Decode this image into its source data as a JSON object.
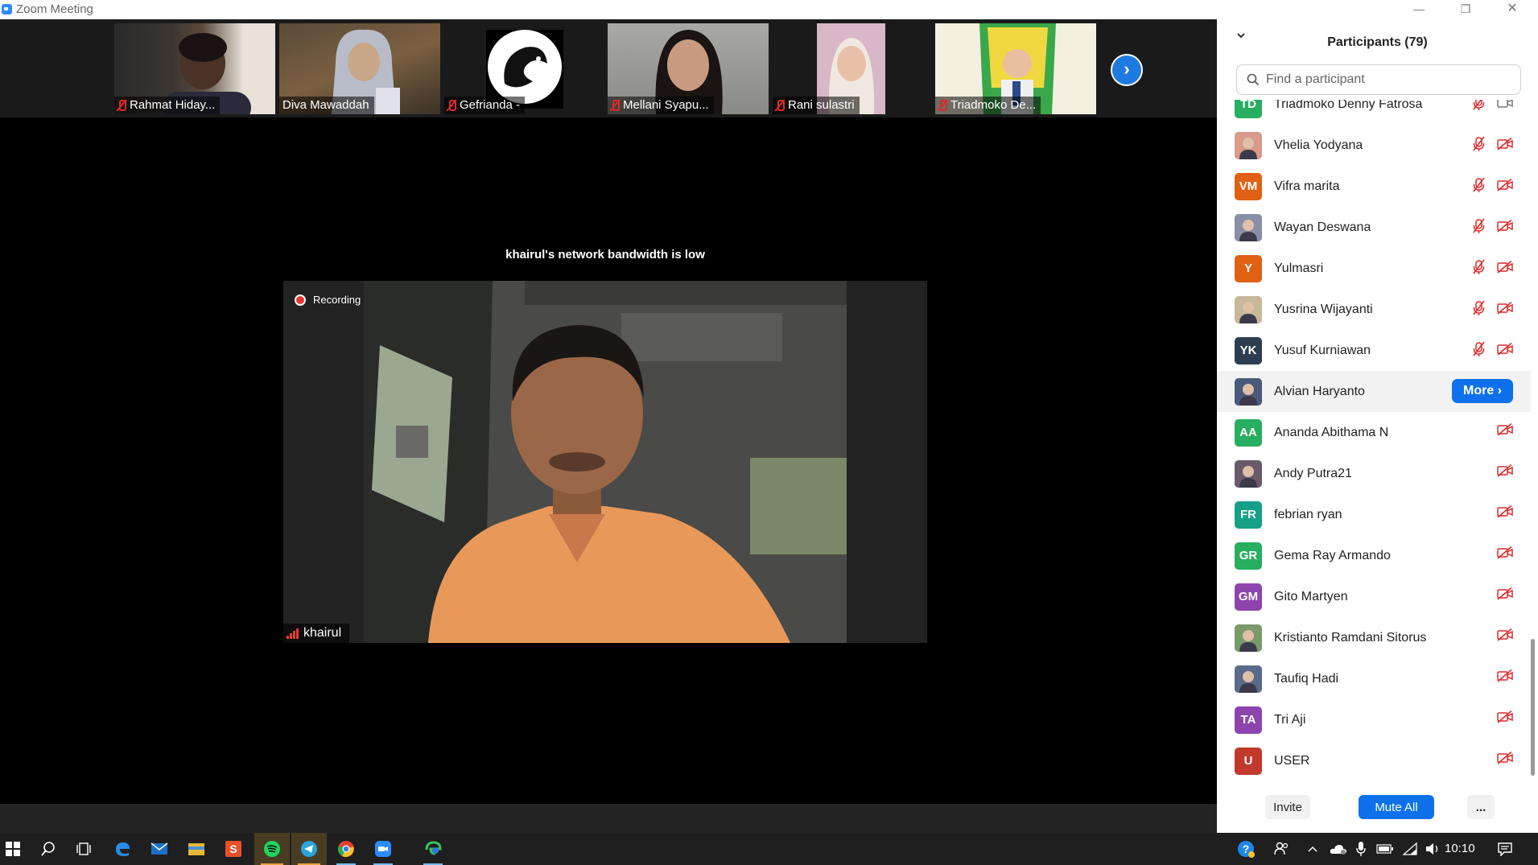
{
  "window": {
    "title": "Zoom Meeting",
    "controls": [
      "minimize",
      "restore",
      "close"
    ]
  },
  "thumbnails": [
    {
      "name": "Rahmat Hiday...",
      "muted": true
    },
    {
      "name": "Diva Mawaddah",
      "muted": false
    },
    {
      "name": "Gefrianda -",
      "muted": true
    },
    {
      "name": "Mellani Syapu...",
      "muted": true
    },
    {
      "name": "Rani sulastri",
      "muted": true
    },
    {
      "name": "Triadmoko De...",
      "muted": true
    }
  ],
  "main": {
    "bandwidth_message": "khairul's network bandwidth is low",
    "recording_label": "Recording",
    "speaker_name": "khairul"
  },
  "panel": {
    "title": "Participants (79)",
    "search_placeholder": "Find a participant",
    "participants": [
      {
        "name": "Triadmoko Denny Fatrosa",
        "initials": "TD",
        "color": "#27ae60",
        "photo": false,
        "muted": true,
        "video_off": false
      },
      {
        "name": "Vhelia Yodyana",
        "initials": "",
        "color": "#d99a8a",
        "photo": true,
        "muted": true,
        "video_off": true
      },
      {
        "name": "Vifra marita",
        "initials": "VM",
        "color": "#e06014",
        "photo": false,
        "muted": true,
        "video_off": true
      },
      {
        "name": "Wayan Deswana",
        "initials": "",
        "color": "#8a8fa8",
        "photo": true,
        "muted": true,
        "video_off": true
      },
      {
        "name": "Yulmasri",
        "initials": "Y",
        "color": "#e06014",
        "photo": false,
        "muted": true,
        "video_off": true
      },
      {
        "name": "Yusrina Wijayanti",
        "initials": "",
        "color": "#c8b89a",
        "photo": true,
        "muted": true,
        "video_off": true
      },
      {
        "name": "Yusuf Kurniawan",
        "initials": "YK",
        "color": "#2c3e50",
        "photo": false,
        "muted": true,
        "video_off": true
      },
      {
        "name": "Alvian Haryanto",
        "initials": "",
        "color": "#4a5a7a",
        "photo": true,
        "hover": true,
        "more_label": "More"
      },
      {
        "name": "Ananda Abithama N",
        "initials": "AA",
        "color": "#27ae60",
        "photo": false,
        "muted": false,
        "video_off": true
      },
      {
        "name": "Andy Putra21",
        "initials": "",
        "color": "#6a5a6a",
        "photo": true,
        "muted": false,
        "video_off": true
      },
      {
        "name": "febrian ryan",
        "initials": "FR",
        "color": "#16a085",
        "photo": false,
        "muted": false,
        "video_off": true
      },
      {
        "name": "Gema Ray Armando",
        "initials": "GR",
        "color": "#27ae60",
        "photo": false,
        "muted": false,
        "video_off": true
      },
      {
        "name": "Gito Martyen",
        "initials": "GM",
        "color": "#8e44ad",
        "photo": false,
        "muted": false,
        "video_off": true
      },
      {
        "name": "Kristianto Ramdani Sitorus",
        "initials": "",
        "color": "#7a9a6a",
        "photo": true,
        "muted": false,
        "video_off": true
      },
      {
        "name": "Taufiq Hadi",
        "initials": "",
        "color": "#5a6a8a",
        "photo": true,
        "muted": false,
        "video_off": true
      },
      {
        "name": "Tri Aji",
        "initials": "TA",
        "color": "#8e44ad",
        "photo": false,
        "muted": false,
        "video_off": true
      },
      {
        "name": "USER",
        "initials": "U",
        "color": "#c0392b",
        "photo": false,
        "muted": false,
        "video_off": true
      }
    ],
    "invite_label": "Invite",
    "mute_all_label": "Mute All",
    "more_options_label": "..."
  },
  "taskbar": {
    "items": [
      "start-icon",
      "search-icon",
      "task-view-icon",
      "edge-icon",
      "mail-icon",
      "file-explorer-icon",
      "sublime-icon",
      "spotify-icon",
      "telegram-icon",
      "chrome-icon",
      "zoom-icon",
      "edge-dev-icon"
    ],
    "clock": "10:10"
  }
}
